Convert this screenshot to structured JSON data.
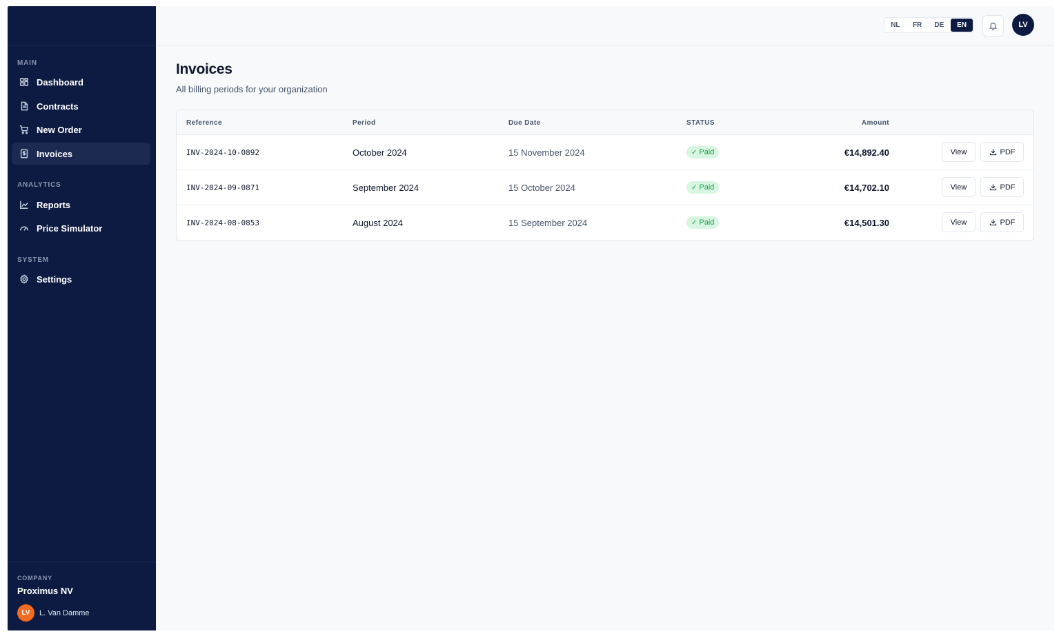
{
  "sidebar": {
    "sections": [
      {
        "label": "MAIN"
      },
      {
        "label": "ANALYTICS"
      },
      {
        "label": "SYSTEM"
      }
    ],
    "items": [
      {
        "label": "Dashboard",
        "icon": "dashboard-icon"
      },
      {
        "label": "Contracts",
        "icon": "document-icon"
      },
      {
        "label": "New Order",
        "icon": "cart-icon"
      },
      {
        "label": "Invoices",
        "icon": "invoice-icon",
        "active": true
      },
      {
        "label": "Reports",
        "icon": "chart-icon"
      },
      {
        "label": "Price Simulator",
        "icon": "gauge-icon"
      },
      {
        "label": "Settings",
        "icon": "gear-icon"
      }
    ],
    "footer": {
      "company_label": "COMPANY",
      "company_name": "Proximus NV",
      "user_initials": "LV",
      "user_name": "L. Van Damme"
    }
  },
  "topbar": {
    "languages": [
      "NL",
      "FR",
      "DE",
      "EN"
    ],
    "active_language": "EN",
    "avatar_initials": "LV"
  },
  "page": {
    "title": "Invoices",
    "subtitle": "All billing periods for your organization"
  },
  "table": {
    "columns": [
      "Reference",
      "Period",
      "Due Date",
      "STATUS",
      "Amount"
    ],
    "rows": [
      {
        "reference": "INV-2024-10-0892",
        "period": "October 2024",
        "due_date": "15 November 2024",
        "status": "Paid",
        "amount": "€14,892.40",
        "view_label": "View",
        "pdf_label": "PDF"
      },
      {
        "reference": "INV-2024-09-0871",
        "period": "September 2024",
        "due_date": "15 October 2024",
        "status": "Paid",
        "amount": "€14,702.10",
        "view_label": "View",
        "pdf_label": "PDF"
      },
      {
        "reference": "INV-2024-08-0853",
        "period": "August 2024",
        "due_date": "15 September 2024",
        "status": "Paid",
        "amount": "€14,501.30",
        "view_label": "View",
        "pdf_label": "PDF"
      }
    ]
  },
  "colors": {
    "sidebar_bg": "#0d1b42",
    "accent": "#0d1b42",
    "paid_badge_bg": "#d8f5e1",
    "paid_badge_text": "#16a34a",
    "avatar_orange": "#f26b21"
  }
}
